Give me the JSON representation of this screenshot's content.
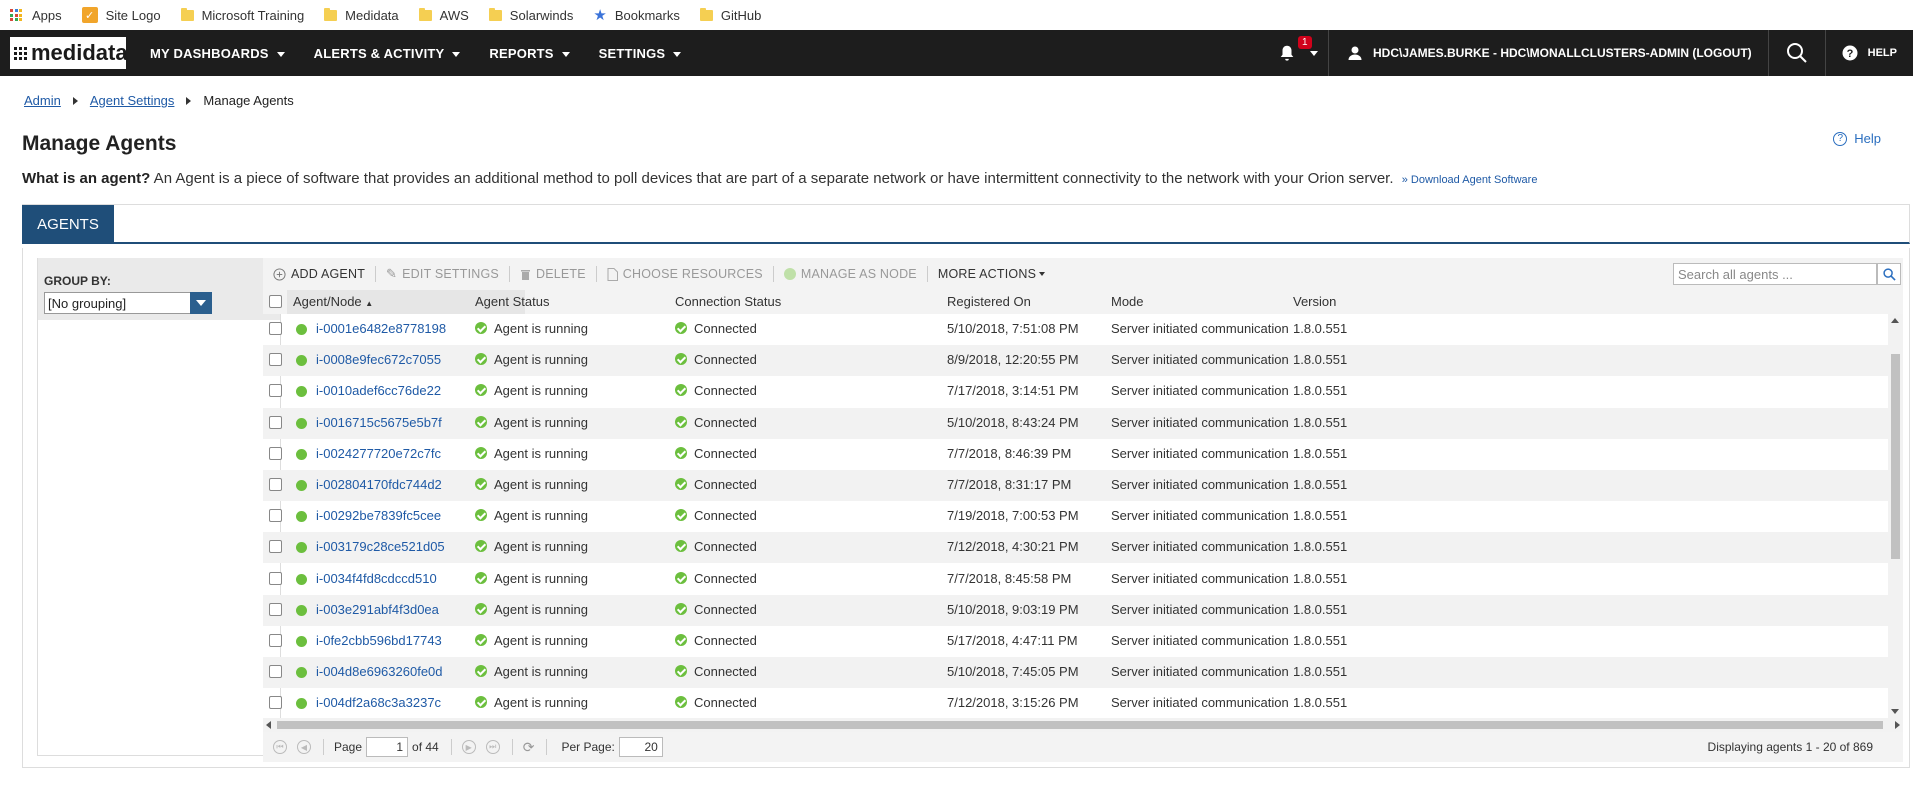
{
  "bookmarks": {
    "items": [
      "Apps",
      "Site Logo",
      "Microsoft Training",
      "Medidata",
      "AWS",
      "Solarwinds",
      "Bookmarks",
      "GitHub"
    ]
  },
  "nav": {
    "logo": "medidata",
    "items": [
      "MY DASHBOARDS",
      "ALERTS & ACTIVITY",
      "REPORTS",
      "SETTINGS"
    ],
    "notification_count": "1",
    "user": "HDC\\JAMES.BURKE - HDC\\MONALLCLUSTERS-ADMIN  (LOGOUT)",
    "help": "HELP"
  },
  "breadcrumb": [
    "Admin",
    "Agent Settings",
    "Manage Agents"
  ],
  "page": {
    "title": "Manage Agents",
    "help": "Help",
    "desc_bold": "What is an agent?",
    "desc_text": " An Agent is a piece of software that provides an additional method to poll devices that are part of a separate network or have intermittent connectivity to the network with your Orion server.",
    "download_link": "» Download Agent Software"
  },
  "tabs": [
    "AGENTS"
  ],
  "groupby": {
    "label": "GROUP BY:",
    "value": "[No grouping]"
  },
  "toolbar": {
    "add": "ADD AGENT",
    "edit": "EDIT SETTINGS",
    "delete": "DELETE",
    "choose": "CHOOSE RESOURCES",
    "manage": "MANAGE AS NODE",
    "more": "MORE ACTIONS",
    "search_placeholder": "Search all agents ..."
  },
  "columns": [
    "Agent/Node",
    "Agent Status",
    "Connection Status",
    "Registered On",
    "Mode",
    "Version"
  ],
  "rows": [
    {
      "agent": "i-0001e6482e8778198",
      "status": "Agent is running",
      "conn": "Connected",
      "registered": "5/10/2018, 7:51:08 PM",
      "mode": "Server initiated communication",
      "version": "1.8.0.551"
    },
    {
      "agent": "i-0008e9fec672c7055",
      "status": "Agent is running",
      "conn": "Connected",
      "registered": "8/9/2018, 12:20:55 PM",
      "mode": "Server initiated communication",
      "version": "1.8.0.551"
    },
    {
      "agent": "i-0010adef6cc76de22",
      "status": "Agent is running",
      "conn": "Connected",
      "registered": "7/17/2018, 3:14:51 PM",
      "mode": "Server initiated communication",
      "version": "1.8.0.551"
    },
    {
      "agent": "i-0016715c5675e5b7f",
      "status": "Agent is running",
      "conn": "Connected",
      "registered": "5/10/2018, 8:43:24 PM",
      "mode": "Server initiated communication",
      "version": "1.8.0.551"
    },
    {
      "agent": "i-0024277720e72c7fc",
      "status": "Agent is running",
      "conn": "Connected",
      "registered": "7/7/2018, 8:46:39 PM",
      "mode": "Server initiated communication",
      "version": "1.8.0.551"
    },
    {
      "agent": "i-002804170fdc744d2",
      "status": "Agent is running",
      "conn": "Connected",
      "registered": "7/7/2018, 8:31:17 PM",
      "mode": "Server initiated communication",
      "version": "1.8.0.551"
    },
    {
      "agent": "i-00292be7839fc5cee",
      "status": "Agent is running",
      "conn": "Connected",
      "registered": "7/19/2018, 7:00:53 PM",
      "mode": "Server initiated communication",
      "version": "1.8.0.551"
    },
    {
      "agent": "i-003179c28ce521d05",
      "status": "Agent is running",
      "conn": "Connected",
      "registered": "7/12/2018, 4:30:21 PM",
      "mode": "Server initiated communication",
      "version": "1.8.0.551"
    },
    {
      "agent": "i-0034f4fd8cdccd510",
      "status": "Agent is running",
      "conn": "Connected",
      "registered": "7/7/2018, 8:45:58 PM",
      "mode": "Server initiated communication",
      "version": "1.8.0.551"
    },
    {
      "agent": "i-003e291abf4f3d0ea",
      "status": "Agent is running",
      "conn": "Connected",
      "registered": "5/10/2018, 9:03:19 PM",
      "mode": "Server initiated communication",
      "version": "1.8.0.551"
    },
    {
      "agent": "i-0fe2cbb596bd17743",
      "status": "Agent is running",
      "conn": "Connected",
      "registered": "5/17/2018, 4:47:11 PM",
      "mode": "Server initiated communication",
      "version": "1.8.0.551"
    },
    {
      "agent": "i-004d8e6963260fe0d",
      "status": "Agent is running",
      "conn": "Connected",
      "registered": "5/10/2018, 7:45:05 PM",
      "mode": "Server initiated communication",
      "version": "1.8.0.551"
    },
    {
      "agent": "i-004df2a68c3a3237c",
      "status": "Agent is running",
      "conn": "Connected",
      "registered": "7/12/2018, 3:15:26 PM",
      "mode": "Server initiated communication",
      "version": "1.8.0.551"
    }
  ],
  "pager": {
    "page_label": "Page",
    "page": "1",
    "of": "of 44",
    "per_page_label": "Per Page:",
    "per_page": "20",
    "display": "Displaying agents 1 - 20 of 869"
  },
  "colors": {
    "nav_bg": "#1d1d1d",
    "tab_active": "#1f4e79",
    "link": "#1f5aa6",
    "ok_green": "#6cbf3e",
    "badge_red": "#d0021b"
  }
}
